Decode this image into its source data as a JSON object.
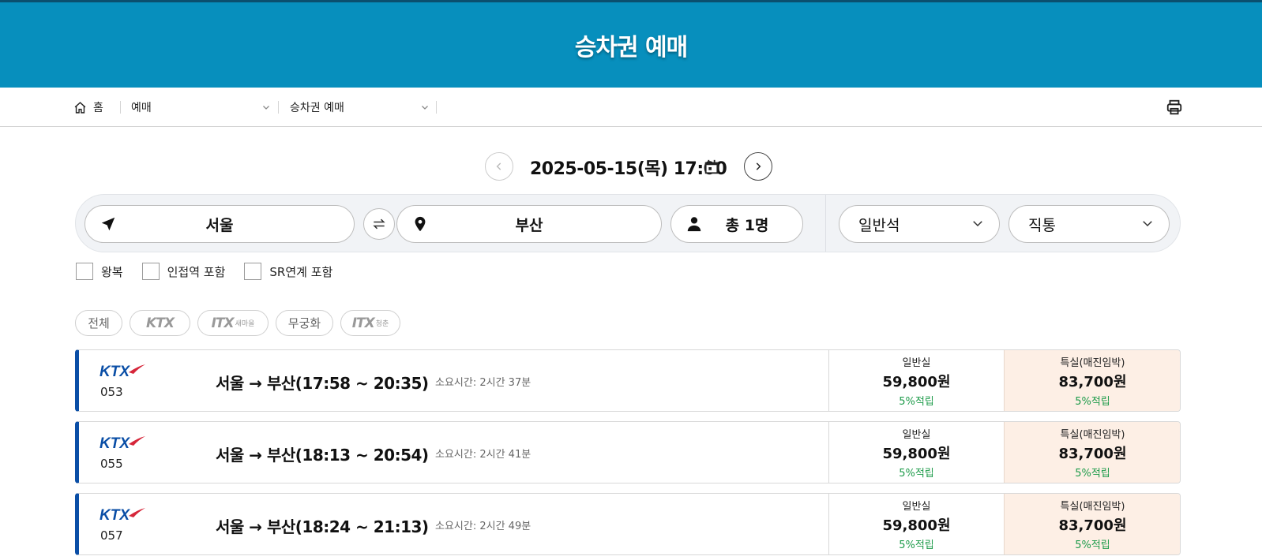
{
  "page": {
    "title": "승차권 예매"
  },
  "breadcrumb": {
    "home_label": "홈",
    "menu1": "예매",
    "menu2": "승차권 예매"
  },
  "date": {
    "text": "2025-05-15(목) 17:00"
  },
  "search": {
    "departure": "서울",
    "arrival": "부산",
    "passengers": "총 1명",
    "seat_class": "일반석",
    "transfer": "직통"
  },
  "options": {
    "round_trip": "왕복",
    "nearby_station": "인접역 포함",
    "sr_link": "SR연계 포함"
  },
  "filters": {
    "all": "전체",
    "ktx": "KTX",
    "itx_saemaeul": "ITX",
    "itx_saemaeul_sub": "새마을",
    "mugunghwa": "무궁화",
    "itx_cheongchun": "ITX",
    "itx_cheongchun_sub": "청춘"
  },
  "trains": [
    {
      "number": "053",
      "route": "서울 → 부산(17:58 ~ 20:35)",
      "duration": "소요시간: 2시간 37분",
      "general": {
        "label": "일반실",
        "price": "59,800원",
        "points": "5%적립"
      },
      "special": {
        "label": "특실(매진임박)",
        "price": "83,700원",
        "points": "5%적립"
      }
    },
    {
      "number": "055",
      "route": "서울 → 부산(18:13 ~ 20:54)",
      "duration": "소요시간: 2시간 41분",
      "general": {
        "label": "일반실",
        "price": "59,800원",
        "points": "5%적립"
      },
      "special": {
        "label": "특실(매진임박)",
        "price": "83,700원",
        "points": "5%적립"
      }
    },
    {
      "number": "057",
      "route": "서울 → 부산(18:24 ~ 21:13)",
      "duration": "소요시간: 2시간 49분",
      "general": {
        "label": "일반실",
        "price": "59,800원",
        "points": "5%적립"
      },
      "special": {
        "label": "특실(매진임박)",
        "price": "83,700원",
        "points": "5%적립"
      }
    }
  ],
  "colors": {
    "header": "#078fbd",
    "ktx_blue": "#0a4ea6",
    "points_green": "#1d9b4a",
    "special_bg": "#fdefe5"
  },
  "icons": [
    "home-icon",
    "print-icon",
    "calendar-icon",
    "send-icon",
    "swap-icon",
    "location-pin-icon",
    "person-icon",
    "chevron-down-icon"
  ]
}
